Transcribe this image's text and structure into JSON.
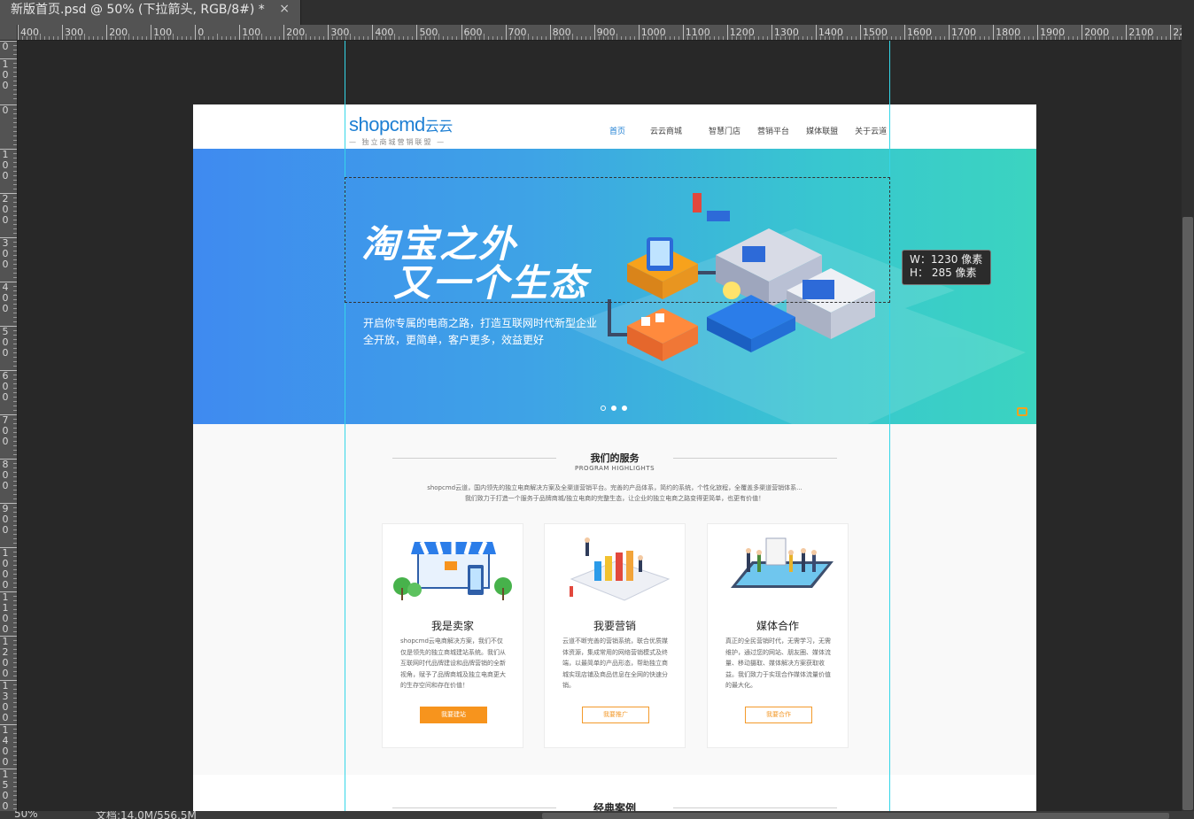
{
  "app": {
    "tab_title": "新版首页.psd @ 50% (下拉箭头, RGB/8#) *",
    "tab_close": "×"
  },
  "rulers": {
    "horizontal": [
      "400",
      "300",
      "200",
      "100",
      "0",
      "100",
      "200",
      "300",
      "400",
      "500",
      "600",
      "700",
      "800",
      "900",
      "1000",
      "1100",
      "1200",
      "1300",
      "1400",
      "1500",
      "1600",
      "1700",
      "1800",
      "1900",
      "2000",
      "2100",
      "22"
    ],
    "vertical": [
      "0",
      "1\n0\n0",
      "0",
      "1\n0\n0",
      "2\n0\n0",
      "3\n0\n0",
      "4\n0\n0",
      "5\n0\n0",
      "6\n0\n0",
      "7\n0\n0",
      "8\n0\n0",
      "9\n0\n0",
      "1\n0\n0\n0",
      "1\n1\n0\n0",
      "1\n2\n0\n0",
      "1\n3\n0\n0",
      "1\n4\n0\n0",
      "1\n5\n0\n0"
    ]
  },
  "status": {
    "zoom": "50%",
    "doc_size": "文档:14.0M/556.5M"
  },
  "size_tooltip": {
    "w_line": "W：1230 像素",
    "h_line": "H：  285 像素"
  },
  "site": {
    "logo_main": "shopcmd",
    "logo_cn": "云云",
    "logo_sub": "— 独立商城营销联盟 —",
    "nav": [
      "首页",
      "云云商城",
      "智慧门店",
      "营销平台",
      "媒体联盟",
      "关于云道"
    ],
    "banner": {
      "title_line1": "淘宝之外",
      "title_line2": "又一个生态",
      "subtitle_line1": "开启你专属的电商之路，打造互联网时代新型企业",
      "subtitle_line2": "全开放，更简单，客户更多，效益更好"
    },
    "services": {
      "title": "我们的服务",
      "subtitle": "PROGRAM HIGHLIGHTS",
      "desc_line1": "shopcmd云道，国内领先的独立电商解决方案及全渠道营销平台。完善的产品体系，简约的系统，个性化旅程，全覆盖多渠道营销体系...",
      "desc_line2": "我们致力于打造一个服务于品牌商城/独立电商的完整生态，让企业的独立电商之路变得更简单，也更有价值！",
      "cards": [
        {
          "title": "我是卖家",
          "text": "shopcmd云电商解决方案，我们不仅仅是领先的独立商城建站系统。我们从互联网时代品牌建设和品牌营销的全新视角，赋予了品牌商城及独立电商更大的生存空间和存在价值！",
          "button": "我要建站"
        },
        {
          "title": "我要营销",
          "text": "云道不断完善的营销系统，联合优质媒体资源，集成常用的网络营销模式及终端，以最简单的产品形态，帮助独立商城实现店铺及商品信息在全网的快速分销。",
          "button": "我要推广"
        },
        {
          "title": "媒体合作",
          "text": "真正的全民营销时代，无需学习，无需维护，通过您的网站、朋友圈、媒体流量、移动摄取、媒体解决方案获取收益。我们致力于实现合作媒体流量价值的最大化。",
          "button": "我要合作"
        }
      ]
    },
    "cases_title": "经典案例"
  },
  "colors": {
    "accent_blue": "#1e7fd3",
    "button_orange": "#f7941d",
    "guide_cyan": "#35d6e8",
    "banner_start": "#3f8af0",
    "banner_end": "#3bd4c0"
  }
}
